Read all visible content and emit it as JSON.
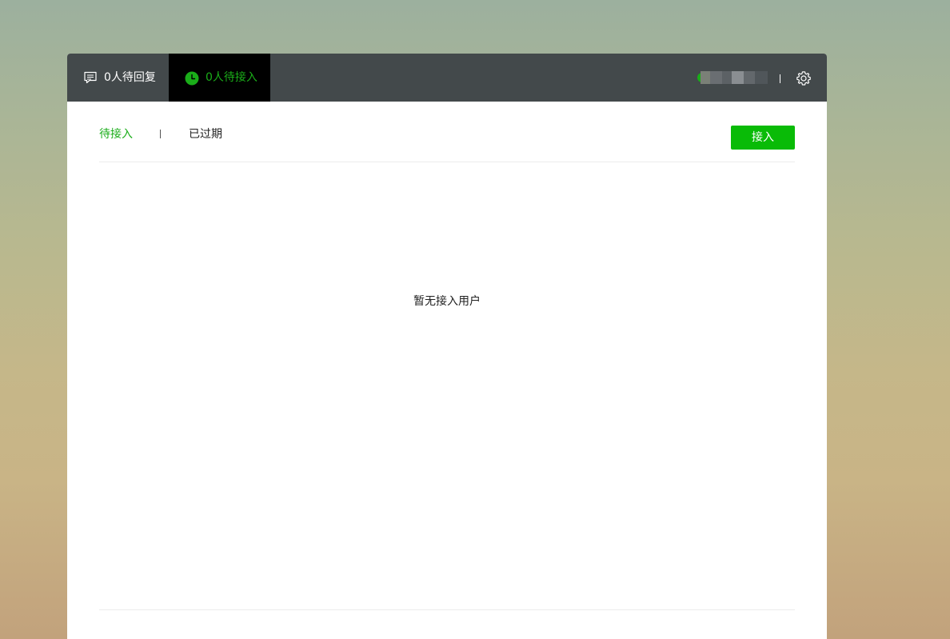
{
  "topbar": {
    "tabs": [
      {
        "label": "0人待回复",
        "icon": "chat-bubble-icon",
        "active": false
      },
      {
        "label": "0人待接入",
        "icon": "clock-icon",
        "active": true
      }
    ],
    "account_status_color": "#1aad19",
    "settings_icon": "gear-icon"
  },
  "subtabs": {
    "items": [
      {
        "label": "待接入",
        "active": true
      },
      {
        "label": "已过期",
        "active": false
      }
    ]
  },
  "actions": {
    "accept_label": "接入"
  },
  "main": {
    "empty_text": "暂无接入用户"
  },
  "colors": {
    "accent": "#1aad19",
    "button": "#09bb07",
    "topbar": "#43494b"
  }
}
